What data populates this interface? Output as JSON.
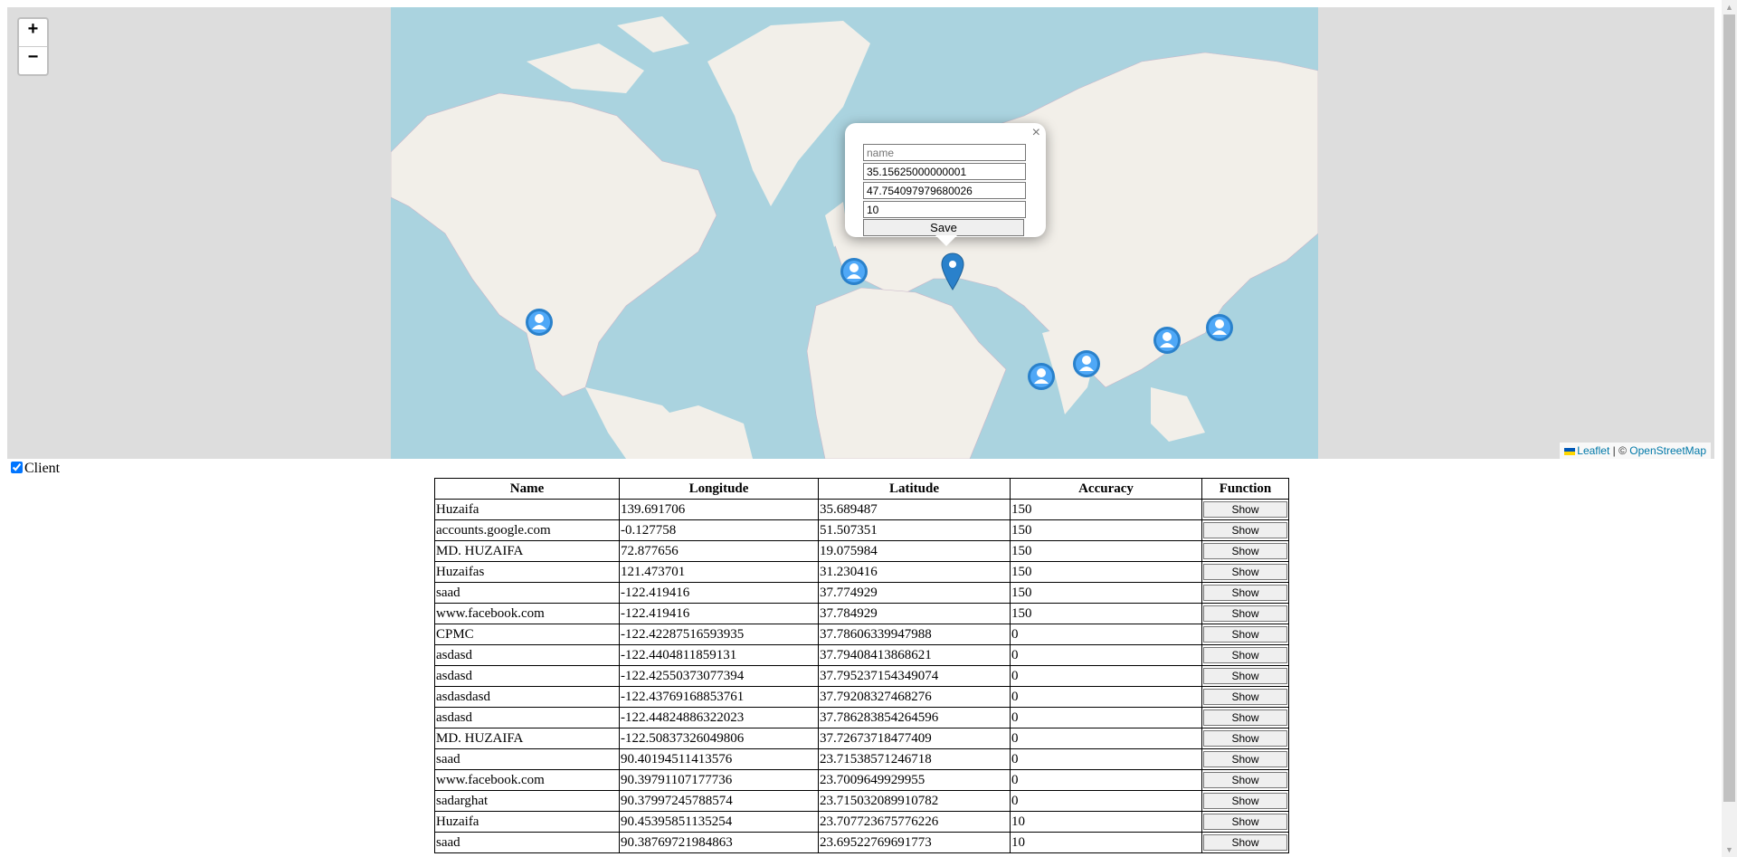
{
  "map": {
    "zoom_in": "+",
    "zoom_out": "−",
    "attribution": {
      "leaflet": "Leaflet",
      "separator": " | © ",
      "osm": "OpenStreetMap"
    },
    "popup": {
      "close": "×",
      "name_placeholder": "name",
      "longitude_value": "35.15625000000001",
      "latitude_value": "47.754097979680026",
      "accuracy_value": "10",
      "save_label": "Save"
    },
    "colors": {
      "ocean": "#aad3df",
      "land": "#f2efe9",
      "marker": "#2a81cb"
    }
  },
  "client_toggle": {
    "label": "Client",
    "checked": true
  },
  "table": {
    "headers": [
      "Name",
      "Longitude",
      "Latitude",
      "Accuracy",
      "Function"
    ],
    "button_label": "Show",
    "rows": [
      [
        "Huzaifa",
        "139.691706",
        "35.689487",
        "150"
      ],
      [
        "accounts.google.com",
        "-0.127758",
        "51.507351",
        "150"
      ],
      [
        "MD. HUZAIFA",
        "72.877656",
        "19.075984",
        "150"
      ],
      [
        "Huzaifas",
        "121.473701",
        "31.230416",
        "150"
      ],
      [
        "saad",
        "-122.419416",
        "37.774929",
        "150"
      ],
      [
        "www.facebook.com",
        "-122.419416",
        "37.784929",
        "150"
      ],
      [
        "CPMC",
        "-122.42287516593935",
        "37.78606339947988",
        "0"
      ],
      [
        "asdasd",
        "-122.4404811859131",
        "37.79408413868621",
        "0"
      ],
      [
        "asdasd",
        "-122.42550373077394",
        "37.795237154349074",
        "0"
      ],
      [
        "asdasdasd",
        "-122.43769168853761",
        "37.79208327468276",
        "0"
      ],
      [
        "asdasd",
        "-122.44824886322023",
        "37.786283854264596",
        "0"
      ],
      [
        "MD. HUZAIFA",
        "-122.50837326049806",
        "37.72673718477409",
        "0"
      ],
      [
        "saad",
        "90.40194511413576",
        "23.71538571246718",
        "0"
      ],
      [
        "www.facebook.com",
        "90.39791107177736",
        "23.7009649929955",
        "0"
      ],
      [
        "sadarghat",
        "90.37997245788574",
        "23.715032089910782",
        "0"
      ],
      [
        "Huzaifa",
        "90.45395851135254",
        "23.707723675776226",
        "10"
      ],
      [
        "saad",
        "90.38769721984863",
        "23.69522769691773",
        "10"
      ]
    ]
  }
}
